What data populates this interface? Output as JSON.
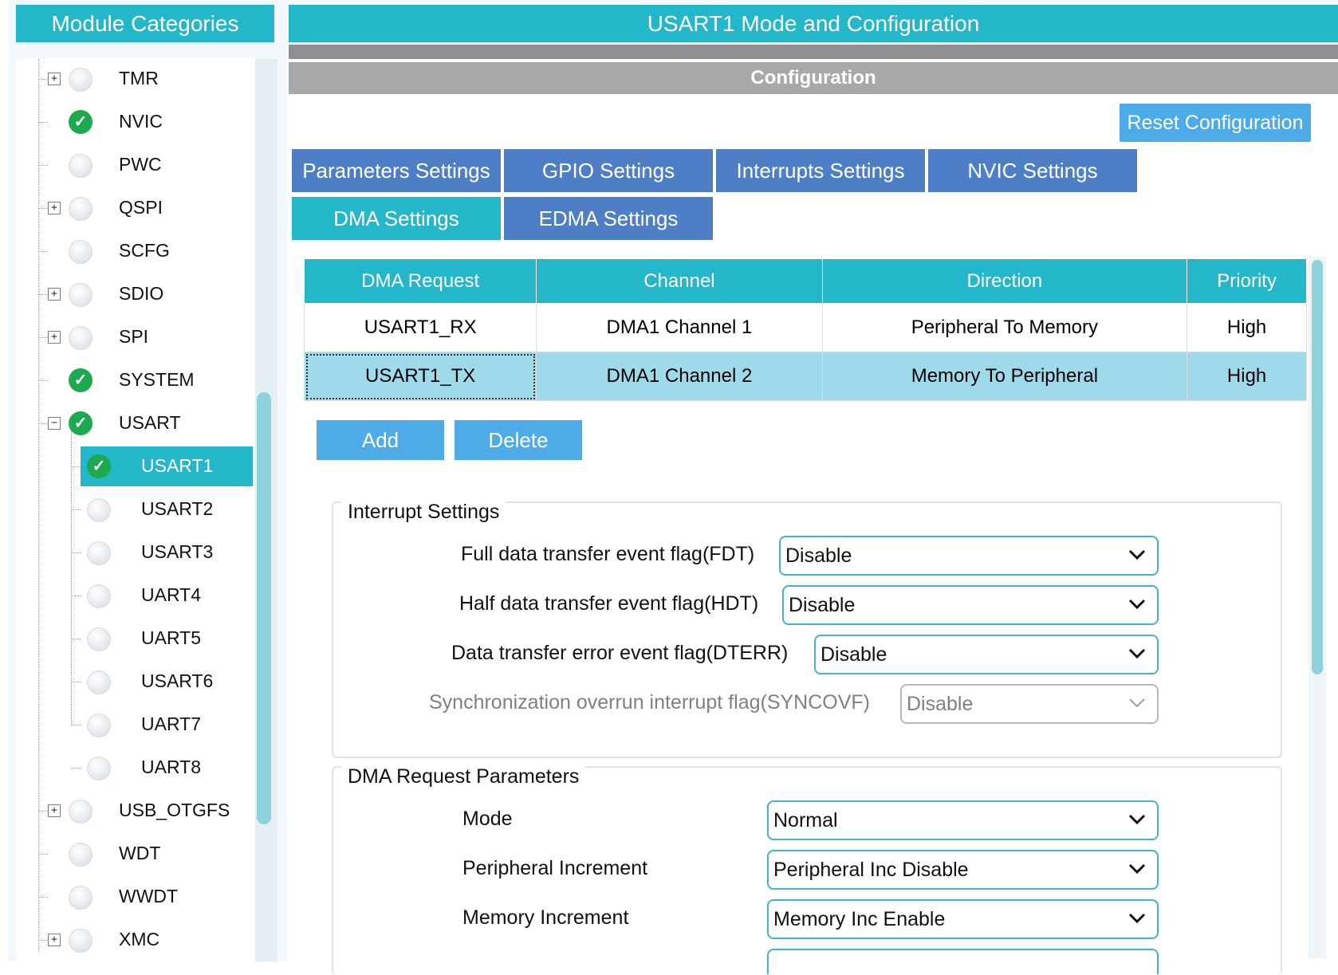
{
  "left_panel": {
    "title": "Module Categories",
    "items": [
      {
        "label": "TMR",
        "status": "none",
        "expander": "+"
      },
      {
        "label": "NVIC",
        "status": "ok",
        "expander": ""
      },
      {
        "label": "PWC",
        "status": "none",
        "expander": ""
      },
      {
        "label": "QSPI",
        "status": "none",
        "expander": "+"
      },
      {
        "label": "SCFG",
        "status": "none",
        "expander": ""
      },
      {
        "label": "SDIO",
        "status": "none",
        "expander": "+"
      },
      {
        "label": "SPI",
        "status": "none",
        "expander": "+"
      },
      {
        "label": "SYSTEM",
        "status": "ok",
        "expander": ""
      },
      {
        "label": "USART",
        "status": "ok",
        "expander": "−"
      },
      {
        "label": "USART1",
        "status": "ok",
        "expander": "",
        "selected": true
      },
      {
        "label": "USART2",
        "status": "none",
        "expander": ""
      },
      {
        "label": "USART3",
        "status": "none",
        "expander": ""
      },
      {
        "label": "UART4",
        "status": "none",
        "expander": ""
      },
      {
        "label": "UART5",
        "status": "none",
        "expander": ""
      },
      {
        "label": "USART6",
        "status": "none",
        "expander": ""
      },
      {
        "label": "UART7",
        "status": "none",
        "expander": ""
      },
      {
        "label": "UART8",
        "status": "none",
        "expander": ""
      },
      {
        "label": "USB_OTGFS",
        "status": "none",
        "expander": "+"
      },
      {
        "label": "WDT",
        "status": "none",
        "expander": ""
      },
      {
        "label": "WWDT",
        "status": "none",
        "expander": ""
      },
      {
        "label": "XMC",
        "status": "none",
        "expander": "+"
      }
    ]
  },
  "main": {
    "title": "USART1 Mode and Configuration",
    "config_label": "Configuration",
    "reset_label": "Reset Configuration",
    "tabs": [
      {
        "label": "Parameters Settings"
      },
      {
        "label": "GPIO Settings"
      },
      {
        "label": "Interrupts Settings"
      },
      {
        "label": "NVIC Settings"
      },
      {
        "label": "DMA Settings",
        "active": true
      },
      {
        "label": "EDMA Settings"
      }
    ],
    "dma_table": {
      "headers": [
        "DMA Request",
        "Channel",
        "Direction",
        "Priority"
      ],
      "rows": [
        [
          "USART1_RX",
          "DMA1 Channel 1",
          "Peripheral To Memory",
          "High"
        ],
        [
          "USART1_TX",
          "DMA1 Channel 2",
          "Memory To Peripheral",
          "High"
        ]
      ]
    },
    "add_label": "Add",
    "delete_label": "Delete",
    "interrupt_group": {
      "title": "Interrupt Settings",
      "fields": [
        {
          "label": "Full data transfer event flag(FDT)",
          "value": "Disable"
        },
        {
          "label": "Half data transfer event flag(HDT)",
          "value": "Disable"
        },
        {
          "label": "Data transfer error event flag(DTERR)",
          "value": "Disable"
        },
        {
          "label": "Synchronization overrun interrupt flag(SYNCOVF)",
          "value": "Disable"
        }
      ]
    },
    "dma_params_group": {
      "title": "DMA Request Parameters",
      "fields": [
        {
          "label": "Mode",
          "value": "Normal"
        },
        {
          "label": "Peripheral Increment",
          "value": "Peripheral Inc Disable"
        },
        {
          "label": "Memory Increment",
          "value": "Memory Inc Enable"
        }
      ]
    }
  },
  "colors": {
    "teal": "#24b6c9",
    "tab_blue": "#4e7fc6",
    "button_blue": "#4dabe8",
    "check_green": "#1daa4f",
    "selected_row": "#9fdaeb"
  }
}
